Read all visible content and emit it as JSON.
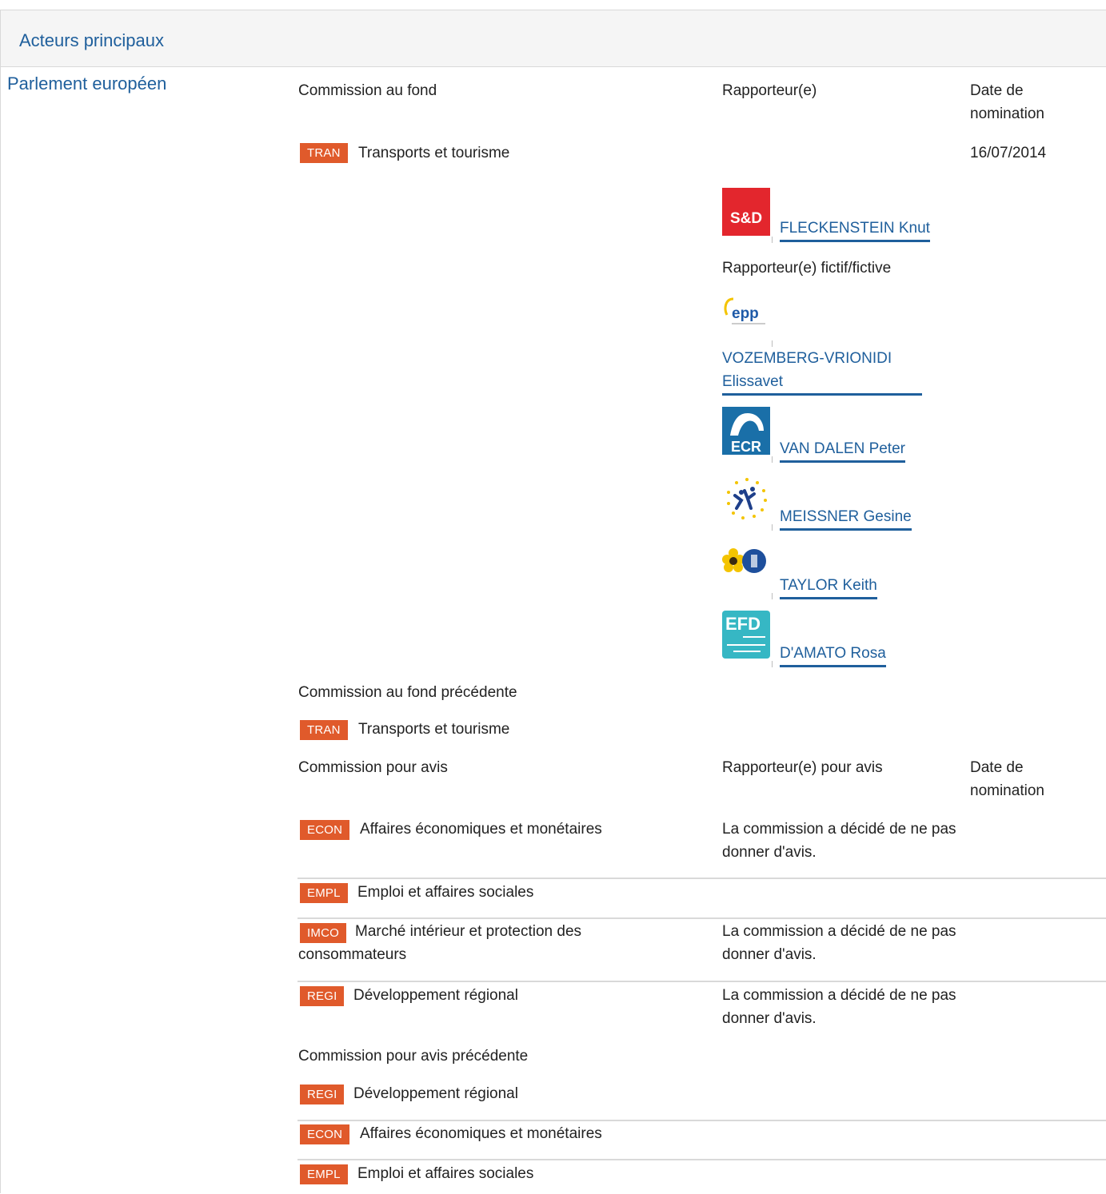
{
  "section": {
    "title": "Acteurs principaux"
  },
  "institution": "Parlement européen",
  "lead": {
    "committee_header": "Commission au fond",
    "rapporteur_header": "Rapporteur(e)",
    "date_header": "Date de nomination",
    "committee": {
      "code": "TRAN",
      "name": "Transports et tourisme",
      "date": "16/07/2014"
    },
    "rapporteur": {
      "group_logo": "S&D",
      "name": "FLECKENSTEIN Knut"
    },
    "shadow_header": "Rapporteur(e) fictif/fictive",
    "shadows": [
      {
        "group_logo": "epp",
        "name": "VOZEMBERG-VRIONIDI Elissavet"
      },
      {
        "group_logo": "ECR",
        "name": "VAN DALEN Peter"
      },
      {
        "group_logo": "alde-logo",
        "name": "MEISSNER Gesine"
      },
      {
        "group_logo": "greens-efa-logo",
        "name": "TAYLOR Keith"
      },
      {
        "group_logo": "EFD",
        "name": "D'AMATO Rosa"
      }
    ]
  },
  "previous_lead": {
    "header": "Commission au fond précédente",
    "committee": {
      "code": "TRAN",
      "name": "Transports et tourisme"
    }
  },
  "opinion": {
    "committee_header": "Commission pour avis",
    "rapporteur_header": "Rapporteur(e) pour avis",
    "date_header": "Date de nomination",
    "rows": [
      {
        "code": "ECON",
        "name": "Affaires économiques et monétaires",
        "note": "La commission a décidé de ne pas donner d'avis."
      },
      {
        "code": "EMPL",
        "name": "Emploi et affaires sociales",
        "note": ""
      },
      {
        "code": "IMCO",
        "name": "Marché intérieur et protection des consommateurs",
        "note": "La commission a décidé de ne pas donner d'avis."
      },
      {
        "code": "REGI",
        "name": "Développement régional",
        "note": "La commission a décidé de ne pas donner d'avis."
      }
    ]
  },
  "previous_opinion": {
    "header": "Commission pour avis précédente",
    "rows": [
      {
        "code": "REGI",
        "name": "Développement régional"
      },
      {
        "code": "ECON",
        "name": "Affaires économiques et monétaires"
      },
      {
        "code": "EMPL",
        "name": "Emploi et affaires sociales"
      }
    ]
  },
  "colors": {
    "link": "#1f5f9c",
    "badge": "#e05a2b",
    "header_bg": "#f5f5f5",
    "border": "#d9d9d9"
  }
}
